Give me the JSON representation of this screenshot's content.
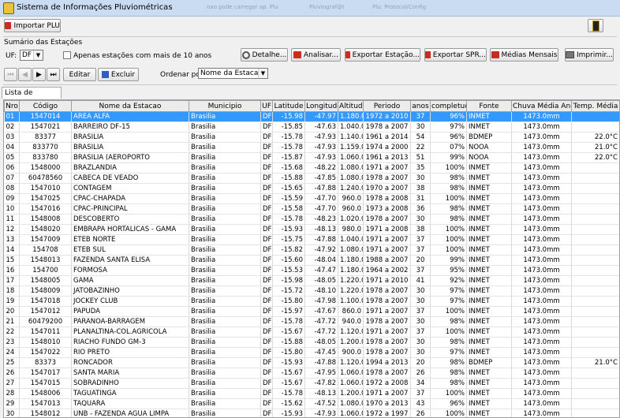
{
  "window": {
    "title": "Sistema de Informações Pluviométricas",
    "ghost_tabs": [
      "nao pode carregar ap. Plu",
      "Pluviograf@t",
      "Plu: Protocol/Config"
    ]
  },
  "toolbar": {
    "import_label": "Importar PLU"
  },
  "summary": {
    "section_title": "Sumário das Estações",
    "uf_label": "UF:",
    "uf_value": "DF",
    "checkbox_label": "Apenas estações com mais de 10 anos",
    "buttons": {
      "detalhe": "Detalhe...",
      "analisar": "Analisar...",
      "exportar_estacao": "Exportar Estação...",
      "exportar_spr": "Exportar SPR...",
      "medias_mensais": "Médias Mensais",
      "imprimir": "Imprimir..."
    },
    "nav": {
      "first": "⏮",
      "prev": "◀",
      "play": "▶",
      "last": "⏭"
    },
    "edit_label": "Editar",
    "delete_label": "Excluir",
    "order_label": "Ordenar por",
    "order_value": "Nome da Estacao"
  },
  "tab_label": "Lista de Estações",
  "columns": [
    "Nro",
    "Código",
    "Nome da Estacao",
    "Municipio",
    "UF",
    "Latitude",
    "Longitude",
    "Altitude",
    "Periodo",
    "anos",
    "completude",
    "Fonte",
    "Chuva Média Anual",
    "Temp. Média"
  ],
  "rows": [
    [
      "01",
      "1547014",
      "AREA ALFA",
      "Brasilia",
      "DF",
      "-15.98",
      "-47.97",
      "1.180.0",
      "1972 a 2010",
      "37",
      "96%",
      "INMET",
      "1473.0mm",
      ""
    ],
    [
      "02",
      "1547021",
      "BARREIRO DF-15",
      "Brasilia",
      "DF",
      "-15.85",
      "-47.63",
      "1.040.0",
      "1978 a 2007",
      "30",
      "97%",
      "INMET",
      "1473.0mm",
      ""
    ],
    [
      "03",
      "83377",
      "BRASILIA",
      "Brasilia",
      "DF",
      "-15.78",
      "-47.93",
      "1.140.0",
      "1961 a 2014",
      "54",
      "96%",
      "BDMEP",
      "1473.0mm",
      "22.0°C"
    ],
    [
      "04",
      "833770",
      "BRASILIA",
      "Brasilia",
      "DF",
      "-15.78",
      "-47.93",
      "1.159.0",
      "1974 a 2000",
      "22",
      "07%",
      "NOOA",
      "1473.0mm",
      "21.0°C"
    ],
    [
      "05",
      "833780",
      "BRASILIA (AEROPORTO",
      "Brasilia",
      "DF",
      "-15.87",
      "-47.93",
      "1.060.0",
      "1961 a 2013",
      "51",
      "99%",
      "NOOA",
      "1473.0mm",
      "22.0°C"
    ],
    [
      "06",
      "1548000",
      "BRAZLANDIA",
      "Brasilia",
      "DF",
      "-15.68",
      "-48.22",
      "1.080.0",
      "1971 a 2007",
      "35",
      "100%",
      "INMET",
      "1473.0mm",
      ""
    ],
    [
      "07",
      "60478560",
      "CABECA DE VEADO",
      "Brasilia",
      "DF",
      "-15.88",
      "-47.85",
      "1.080.0",
      "1978 a 2007",
      "30",
      "98%",
      "INMET",
      "1473.0mm",
      ""
    ],
    [
      "08",
      "1547010",
      "CONTAGEM",
      "Brasilia",
      "DF",
      "-15.65",
      "-47.88",
      "1.240.0",
      "1970 a 2007",
      "38",
      "98%",
      "INMET",
      "1473.0mm",
      ""
    ],
    [
      "09",
      "1547025",
      "CPAC-CHAPADA",
      "Brasilia",
      "DF",
      "-15.59",
      "-47.70",
      "960.0",
      "1978 a 2008",
      "31",
      "100%",
      "INMET",
      "1473.0mm",
      ""
    ],
    [
      "10",
      "1547016",
      "CPAC-PRINCIPAL",
      "Brasilia",
      "DF",
      "-15.58",
      "-47.70",
      "960.0",
      "1973 a 2008",
      "36",
      "98%",
      "INMET",
      "1473.0mm",
      ""
    ],
    [
      "11",
      "1548008",
      "DESCOBERTO",
      "Brasilia",
      "DF",
      "-15.78",
      "-48.23",
      "1.020.0",
      "1978 a 2007",
      "30",
      "98%",
      "INMET",
      "1473.0mm",
      ""
    ],
    [
      "12",
      "1548020",
      "EMBRAPA HORTALICAS - GAMA",
      "Brasilia",
      "DF",
      "-15.93",
      "-48.13",
      "980.0",
      "1971 a 2008",
      "38",
      "100%",
      "INMET",
      "1473.0mm",
      ""
    ],
    [
      "13",
      "1547009",
      "ETEB NORTE",
      "Brasilia",
      "DF",
      "-15.75",
      "-47.88",
      "1.040.0",
      "1971 a 2007",
      "37",
      "100%",
      "INMET",
      "1473.0mm",
      ""
    ],
    [
      "14",
      "154708",
      "ETEB SUL",
      "Brasilia",
      "DF",
      "-15.82",
      "-47.92",
      "1.080.0",
      "1971 a 2007",
      "37",
      "100%",
      "INMET",
      "1473.0mm",
      ""
    ],
    [
      "15",
      "1548013",
      "FAZENDA SANTA ELISA",
      "Brasilia",
      "DF",
      "-15.60",
      "-48.04",
      "1.180.0",
      "1988 a 2007",
      "20",
      "99%",
      "INMET",
      "1473.0mm",
      ""
    ],
    [
      "16",
      "154700",
      "FORMOSA",
      "Brasilia",
      "DF",
      "-15.53",
      "-47.47",
      "1.180.0",
      "1964 a 2002",
      "37",
      "95%",
      "INMET",
      "1473.0mm",
      ""
    ],
    [
      "17",
      "1548005",
      "GAMA",
      "Brasilia",
      "DF",
      "-15.98",
      "-48.05",
      "1.220.0",
      "1971 a 2010",
      "41",
      "92%",
      "INMET",
      "1473.0mm",
      ""
    ],
    [
      "18",
      "1548009",
      "JATOBAZINHO",
      "Brasilia",
      "DF",
      "-15.72",
      "-48.10",
      "1.220.0",
      "1978 a 2007",
      "30",
      "97%",
      "INMET",
      "1473.0mm",
      ""
    ],
    [
      "19",
      "1547018",
      "JOCKEY CLUB",
      "Brasilia",
      "DF",
      "-15.80",
      "-47.98",
      "1.100.0",
      "1978 a 2007",
      "30",
      "97%",
      "INMET",
      "1473.0mm",
      ""
    ],
    [
      "20",
      "1547012",
      "PAPUDA",
      "Brasilia",
      "DF",
      "-15.97",
      "-47.67",
      "860.0",
      "1971 a 2007",
      "37",
      "100%",
      "INMET",
      "1473.0mm",
      ""
    ],
    [
      "21",
      "60479200",
      "PARANOA-BARRAGEM",
      "Brasilia",
      "DF",
      "-15.78",
      "-47.72",
      "940.0",
      "1978 a 2007",
      "30",
      "98%",
      "INMET",
      "1473.0mm",
      ""
    ],
    [
      "22",
      "1547011",
      "PLANALTINA-COL.AGRICOLA",
      "Brasilia",
      "DF",
      "-15.67",
      "-47.72",
      "1.120.0",
      "1971 a 2007",
      "37",
      "100%",
      "INMET",
      "1473.0mm",
      ""
    ],
    [
      "23",
      "1548010",
      "RIACHO FUNDO GM-3",
      "Brasilia",
      "DF",
      "-15.88",
      "-48.05",
      "1.200.0",
      "1978 a 2007",
      "30",
      "98%",
      "INMET",
      "1473.0mm",
      ""
    ],
    [
      "24",
      "1547022",
      "RIO PRETO",
      "Brasilia",
      "DF",
      "-15.80",
      "-47.45",
      "900.0",
      "1978 a 2007",
      "30",
      "97%",
      "INMET",
      "1473.0mm",
      ""
    ],
    [
      "25",
      "83373",
      "RONCADOR",
      "Brasilia",
      "DF",
      "-15.93",
      "-47.88",
      "1.120.0",
      "1994 a 2013",
      "20",
      "98%",
      "BDMEP",
      "1473.0mm",
      "21.0°C"
    ],
    [
      "26",
      "1547017",
      "SANTA MARIA",
      "Brasilia",
      "DF",
      "-15.67",
      "-47.95",
      "1.060.0",
      "1978 a 2007",
      "26",
      "98%",
      "INMET",
      "1473.0mm",
      ""
    ],
    [
      "27",
      "1547015",
      "SOBRADINHO",
      "Brasilia",
      "DF",
      "-15.67",
      "-47.82",
      "1.060.0",
      "1972 a 2008",
      "34",
      "98%",
      "INMET",
      "1473.0mm",
      ""
    ],
    [
      "28",
      "1548006",
      "TAGUATINGA",
      "Brasilia",
      "DF",
      "-15.78",
      "-48.13",
      "1.200.0",
      "1971 a 2007",
      "37",
      "100%",
      "INMET",
      "1473.0mm",
      ""
    ],
    [
      "29",
      "1547013",
      "TAQUARA",
      "Brasilia",
      "DF",
      "-15.62",
      "-47.52",
      "1.080.0",
      "1970 a 2013",
      "43",
      "96%",
      "INMET",
      "1473.0mm",
      ""
    ],
    [
      "30",
      "1548012",
      "UNB - FAZENDA AGUA LIMPA",
      "Brasilia",
      "DF",
      "-15.93",
      "-47.93",
      "1.060.0",
      "1972 a 1997",
      "26",
      "100%",
      "INMET",
      "1473.0mm",
      ""
    ]
  ]
}
